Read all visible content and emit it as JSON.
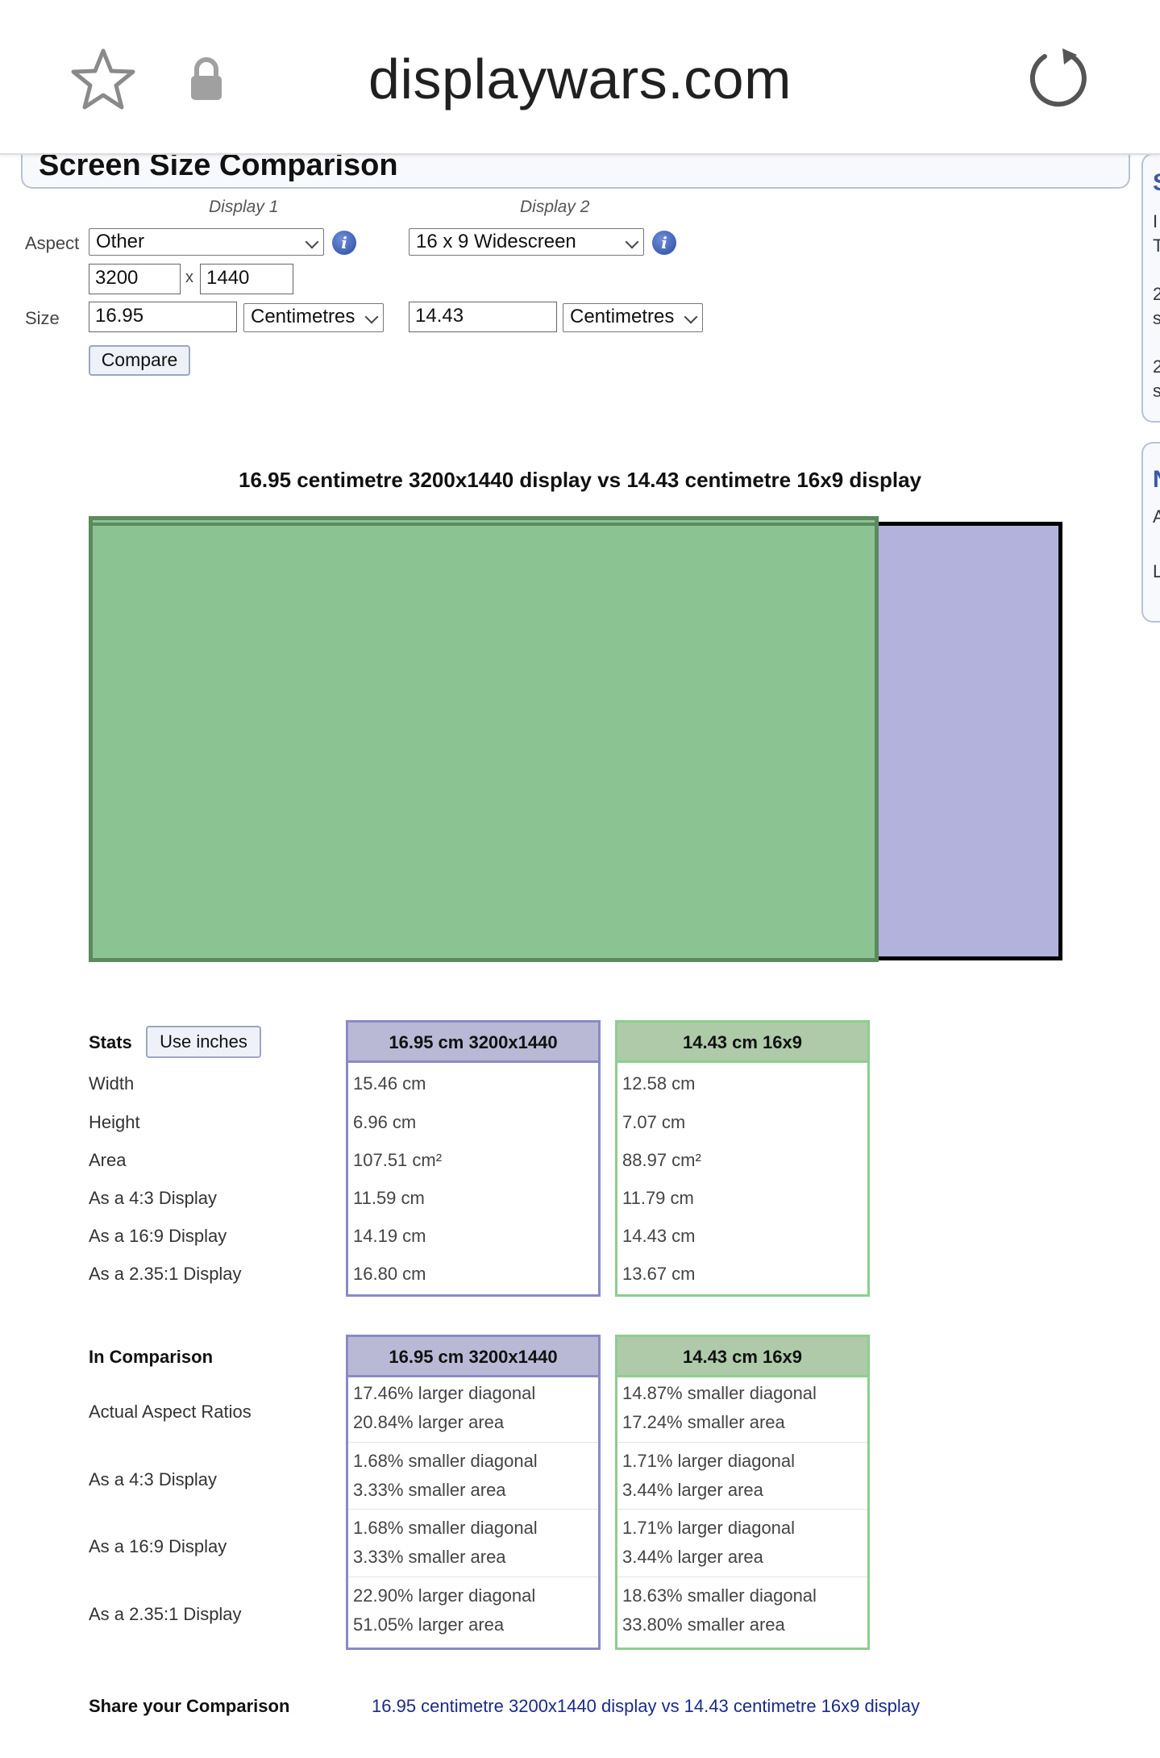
{
  "browser": {
    "url": "displaywars.com",
    "icons": [
      "star-icon",
      "lock-icon",
      "reload-icon"
    ]
  },
  "page": {
    "title": "Screen Size Comparison"
  },
  "form": {
    "display1_label": "Display 1",
    "display2_label": "Display 2",
    "aspect_label": "Aspect",
    "size_label": "Size",
    "display1": {
      "aspect_selected": "Other",
      "width": "3200",
      "times": "x",
      "height": "1440",
      "size": "16.95",
      "unit_selected": "Centimetres"
    },
    "display2": {
      "aspect_selected": "16 x 9 Widescreen",
      "size": "14.43",
      "unit_selected": "Centimetres"
    },
    "compare_button": "Compare"
  },
  "comparison": {
    "title": "16.95 centimetre 3200x1440 display vs 14.43 centimetre 16x9 display",
    "colors": {
      "display1_fill": "#b2b2dc",
      "display2_fill": "#8bc393",
      "display2_border": "#5c8a5e"
    }
  },
  "stats": {
    "header": "Stats",
    "toggle_button": "Use inches",
    "col1_header": "16.95 cm 3200x1440",
    "col2_header": "14.43 cm 16x9",
    "rows": [
      {
        "label": "Width",
        "d1": "15.46 cm",
        "d2": "12.58 cm"
      },
      {
        "label": "Height",
        "d1": "6.96 cm",
        "d2": "7.07 cm"
      },
      {
        "label": "Area",
        "d1": "107.51 cm²",
        "d2": "88.97 cm²"
      },
      {
        "label": "As a 4:3 Display",
        "d1": "11.59 cm",
        "d2": "11.79 cm"
      },
      {
        "label": "As a 16:9 Display",
        "d1": "14.19 cm",
        "d2": "14.43 cm"
      },
      {
        "label": "As a 2.35:1 Display",
        "d1": "16.80 cm",
        "d2": "13.67 cm"
      }
    ]
  },
  "in_comparison": {
    "header": "In Comparison",
    "col1_header": "16.95 cm 3200x1440",
    "col2_header": "14.43 cm 16x9",
    "rows": [
      {
        "label": "Actual Aspect Ratios",
        "d1": [
          "17.46% larger diagonal",
          "20.84% larger area"
        ],
        "d2": [
          "14.87% smaller diagonal",
          "17.24% smaller area"
        ]
      },
      {
        "label": "As a 4:3 Display",
        "d1": [
          "1.68% smaller diagonal",
          "3.33% smaller area"
        ],
        "d2": [
          "1.71% larger diagonal",
          "3.44% larger area"
        ]
      },
      {
        "label": "As a 16:9 Display",
        "d1": [
          "1.68% smaller diagonal",
          "3.33% smaller area"
        ],
        "d2": [
          "1.71% larger diagonal",
          "3.44% larger area"
        ]
      },
      {
        "label": "As a 2.35:1 Display",
        "d1": [
          "22.90% larger diagonal",
          "51.05% larger area"
        ],
        "d2": [
          "18.63% smaller diagonal",
          "33.80% smaller area"
        ]
      }
    ]
  },
  "share": {
    "label": "Share your Comparison",
    "link_text": "16.95 centimetre 3200x1440 display vs 14.43 centimetre 16x9 display"
  },
  "side_panel_chars": [
    "S",
    "I",
    "T",
    "2",
    "s",
    "2",
    "s",
    "N",
    "A",
    "L"
  ]
}
